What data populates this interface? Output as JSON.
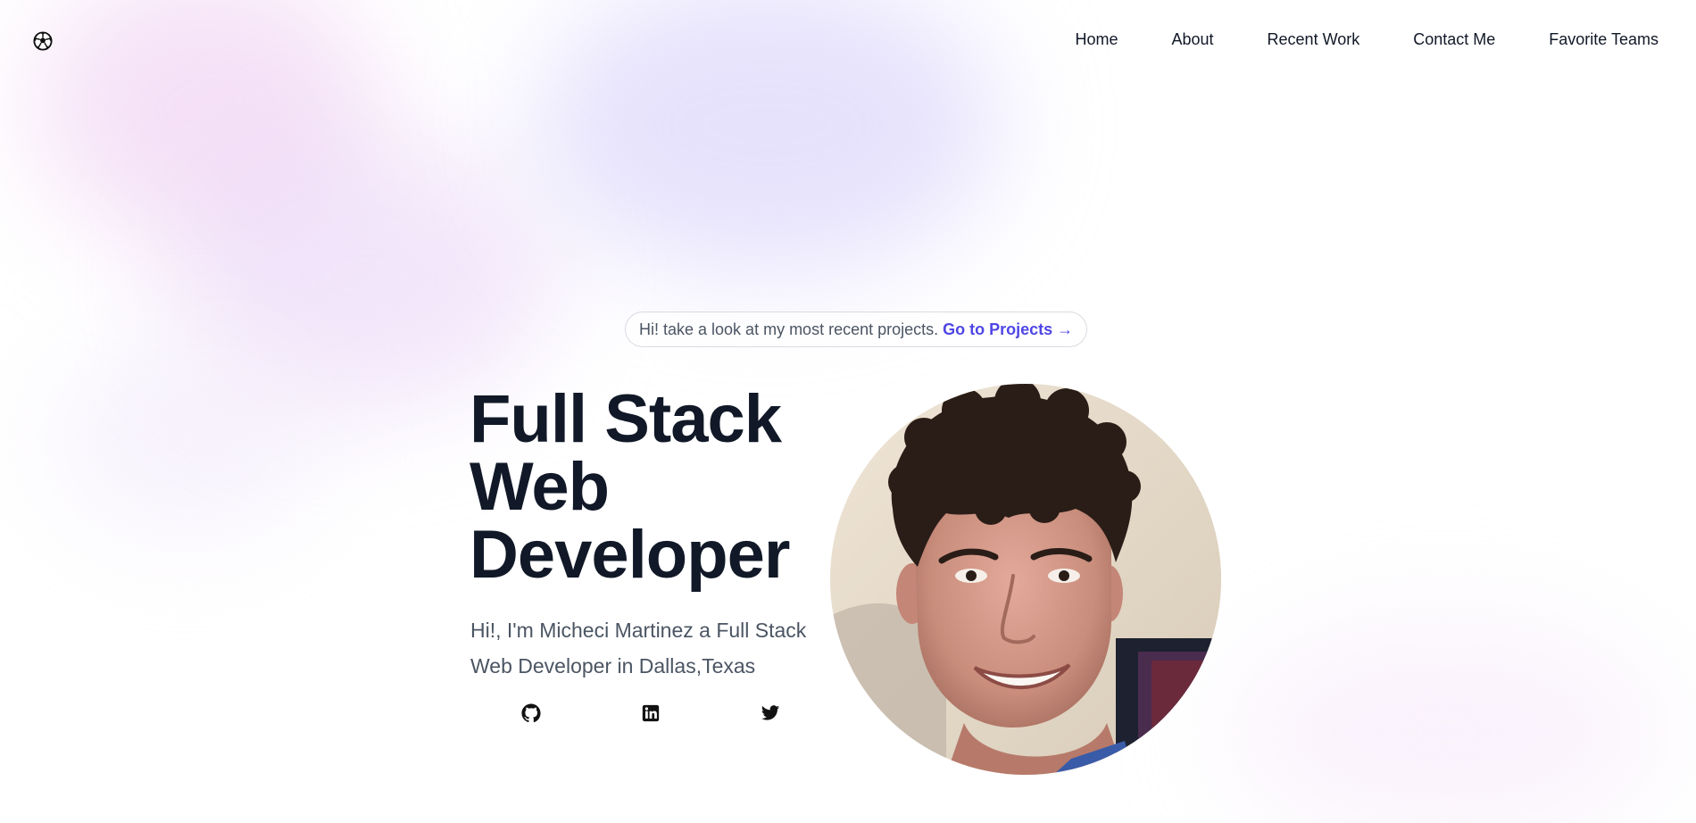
{
  "header": {
    "logo_icon": "soccer-ball-icon",
    "nav": [
      {
        "label": "Home"
      },
      {
        "label": "About"
      },
      {
        "label": "Recent Work"
      },
      {
        "label": "Contact Me"
      },
      {
        "label": "Favorite Teams"
      }
    ]
  },
  "announcement": {
    "text": "Hi! take a look at my most recent projects.",
    "link_label": "Go to Projects →"
  },
  "hero": {
    "title_lines": [
      "Full Stack",
      "Web",
      "Developer"
    ],
    "subtitle": "Hi!, I'm Micheci Martinez a Full Stack Web Developer in Dallas,Texas",
    "social": [
      {
        "icon": "github-icon"
      },
      {
        "icon": "linkedin-icon"
      },
      {
        "icon": "twitter-icon"
      }
    ],
    "portrait_icon": "profile-photo"
  },
  "colors": {
    "accent": "#4f46e5",
    "heading": "#111827",
    "body_text": "#4b5563"
  }
}
